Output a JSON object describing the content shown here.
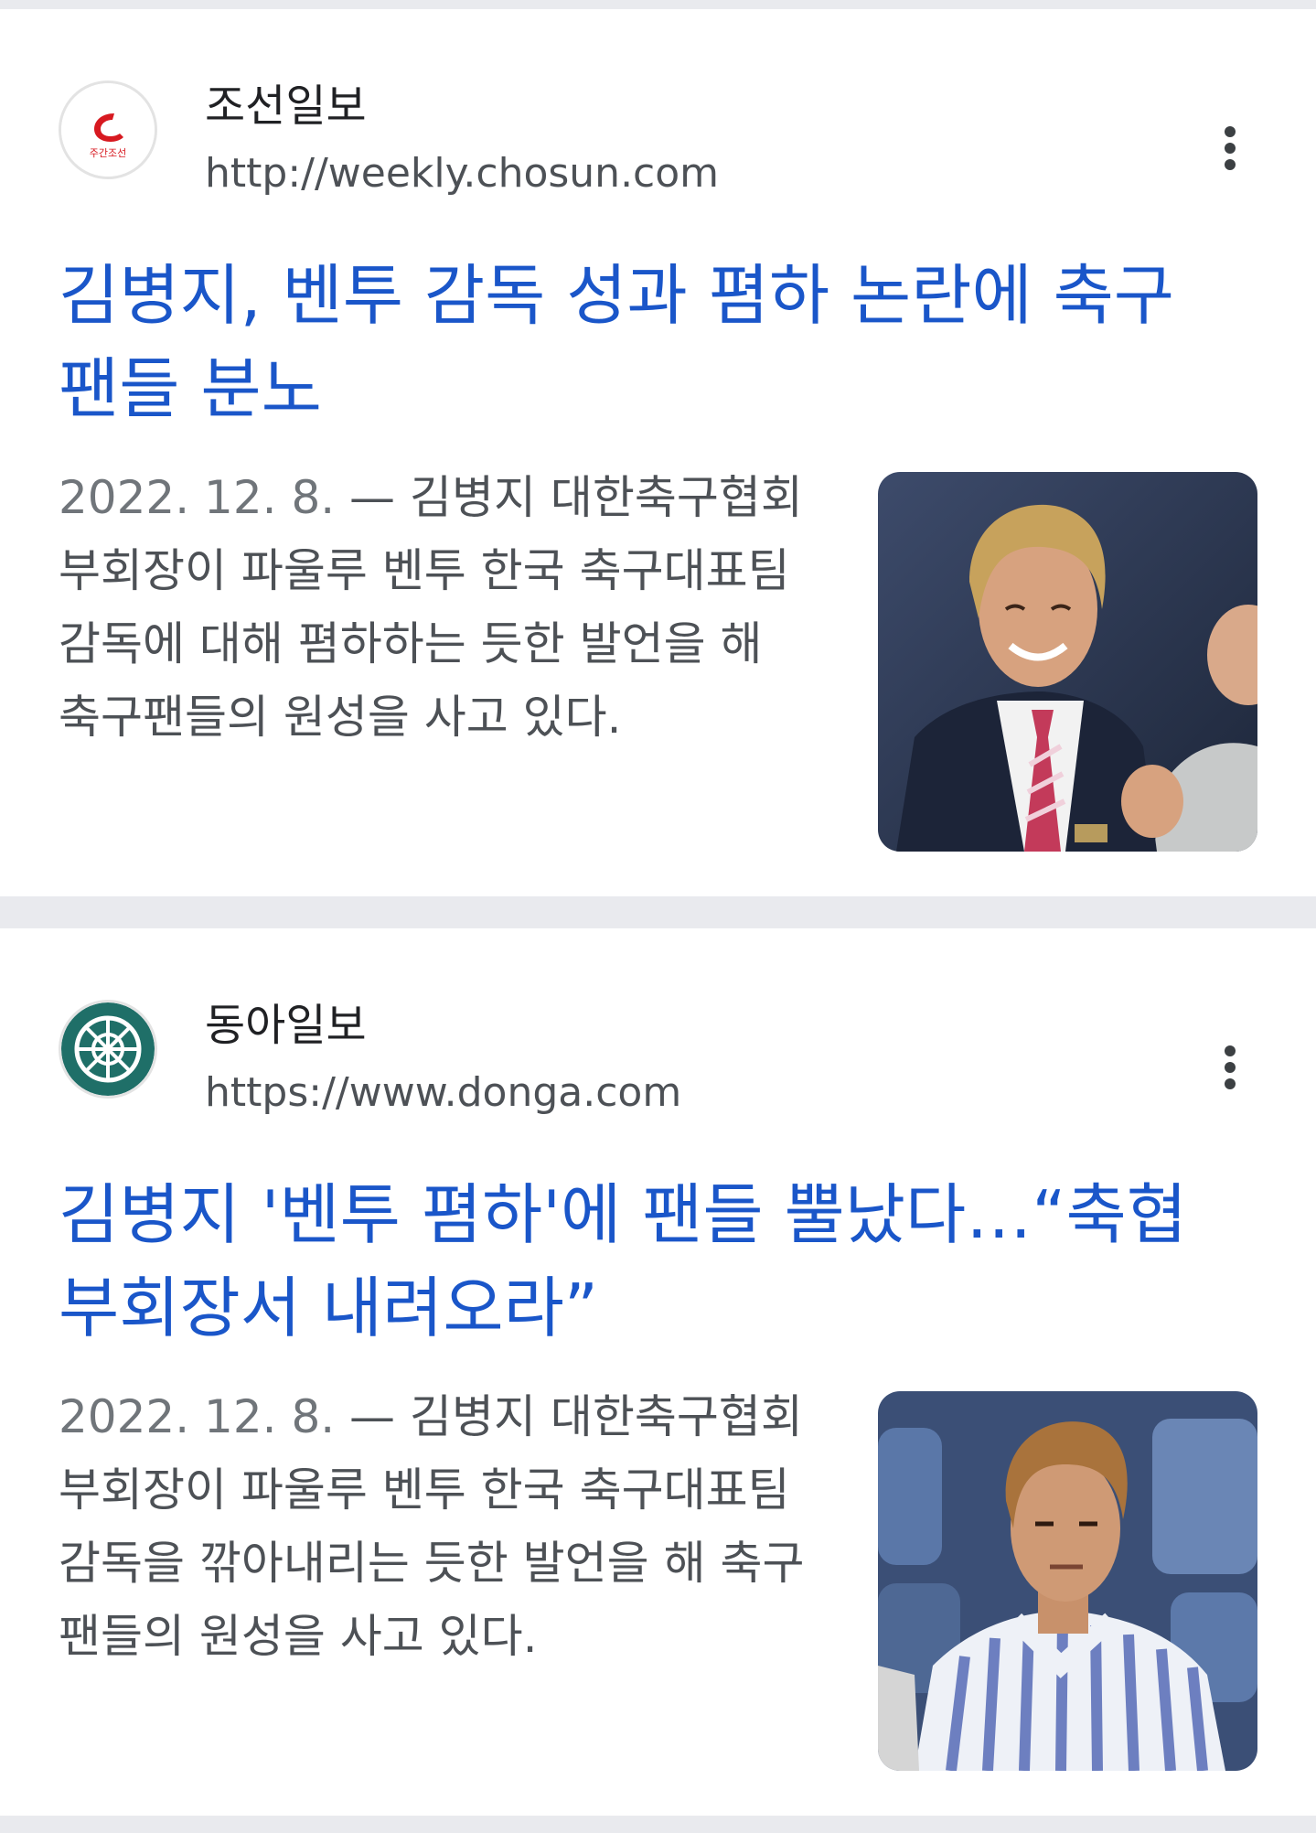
{
  "results": [
    {
      "source_name": "조선일보",
      "source_url": "http://weekly.chosun.com",
      "logo_text": "주간조선",
      "headline": "김병지, 벤투 감독 성과 폄하 논란에 축구 팬들 분노",
      "date": "2022. 12. 8.",
      "snippet": "김병지 대한축구협회 부회장이 파울루 벤투 한국 축구대표팀 감독에 대해 폄하하는 듯한 발언을 해 축구팬들의 원성을 사고 있다.",
      "logo_color": "#d71920"
    },
    {
      "source_name": "동아일보",
      "source_url": "https://www.donga.com",
      "headline": "김병지 '벤투 폄하'에 팬들 뿔났다…“축협 부회장서 내려오라”",
      "date": "2022. 12. 8.",
      "snippet": "김병지 대한축구협회 부회장이 파울루 벤투 한국 축구대표팀 감독을 깎아내리는 듯한 발언을 해 축구팬들의 원성을 사고 있다.",
      "logo_color": "#1f6f68"
    }
  ],
  "snippet_separator": " — ",
  "colors": {
    "headline": "#1a56c9",
    "background": "#e9eaee",
    "card": "#ffffff"
  },
  "icons": [
    "more-vert-icon"
  ]
}
